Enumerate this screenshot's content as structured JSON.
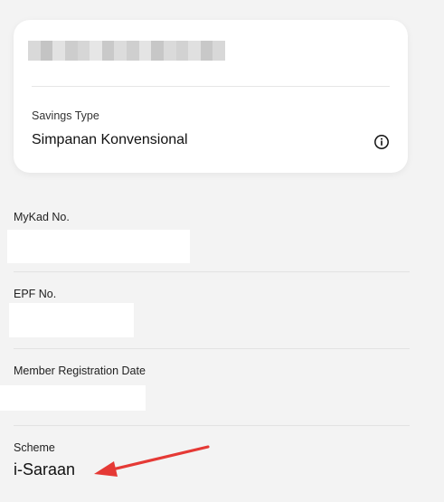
{
  "account_card": {
    "savings_type_label": "Savings Type",
    "savings_type_value": "Simpanan Konvensional",
    "info_icon": "info-circle-icon"
  },
  "fields": {
    "mykad_label": "MyKad No.",
    "epf_label": "EPF No.",
    "member_registration_date_label": "Member Registration Date",
    "scheme_label": "Scheme",
    "scheme_value": "i-Saraan"
  },
  "annotation": {
    "arrow_color": "#e53935",
    "arrow_icon": "arrow-pointer-icon"
  },
  "colors": {
    "background": "#f3f3f3",
    "card": "#ffffff"
  }
}
